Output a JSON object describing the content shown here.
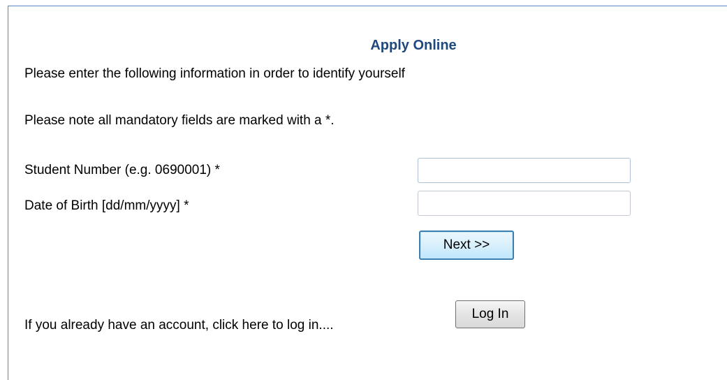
{
  "form": {
    "title": "Apply Online",
    "intro": "Please enter the following information in order to identify yourself",
    "mandatory_note": "Please note all mandatory fields are marked with a *.",
    "student_number_label": "Student Number (e.g. 0690001) *",
    "student_number_value": "",
    "dob_label": "Date of Birth [dd/mm/yyyy] *",
    "dob_value": "",
    "next_button": "Next >>",
    "login_prompt": "If you already have an account, click here to log in....",
    "login_button": "Log In"
  },
  "colors": {
    "title": "#1f497d",
    "frame_border": "#5b86c2",
    "focused_button_border": "#3c7fb1"
  }
}
